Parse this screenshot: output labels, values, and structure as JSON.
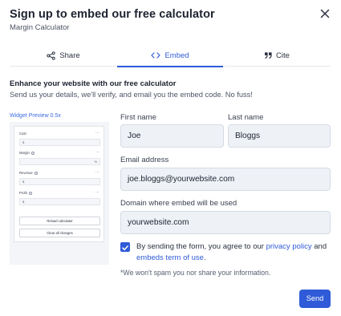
{
  "header": {
    "title": "Sign up to embed our free calculator",
    "subtitle": "Margin Calculator",
    "close_icon": "close-icon"
  },
  "tabs": [
    {
      "label": "Share",
      "icon": "share-icon",
      "active": false
    },
    {
      "label": "Embed",
      "icon": "code-icon",
      "active": true
    },
    {
      "label": "Cite",
      "icon": "quote-icon",
      "active": false
    }
  ],
  "section": {
    "title": "Enhance your website with our free calculator",
    "description": "Send us your details, we'll verify, and email you the embed code. No fuss!"
  },
  "preview": {
    "label": "Widget Preview 0.5x",
    "fields": [
      {
        "label": "Cost",
        "value": "$",
        "has_info": false
      },
      {
        "label": "Margin",
        "value": "%",
        "has_info": true
      },
      {
        "label": "Revenue",
        "value": "$",
        "has_info": true
      },
      {
        "label": "Profit",
        "value": "$",
        "has_info": true
      }
    ],
    "reload_label": "Reload calculator",
    "clear_label": "Clear all changes",
    "menu_dots": "⋯"
  },
  "form": {
    "first_name_label": "First name",
    "first_name_value": "Joe",
    "last_name_label": "Last name",
    "last_name_value": "Bloggs",
    "email_label": "Email address",
    "email_value": "joe.bloggs@yourwebsite.com",
    "domain_label": "Domain where embed will be used",
    "domain_value": "yourwebsite.com",
    "consent_checked": true,
    "consent_prefix": "By sending the form, you agree to our ",
    "consent_link_1": "privacy policy",
    "consent_mid": " and ",
    "consent_link_2": "embeds term of use",
    "consent_suffix": ".",
    "note": "*We won't spam you nor share your information.",
    "send_label": "Send"
  },
  "colors": {
    "accent": "#2f5bd8",
    "input_bg": "#eef2f7"
  }
}
